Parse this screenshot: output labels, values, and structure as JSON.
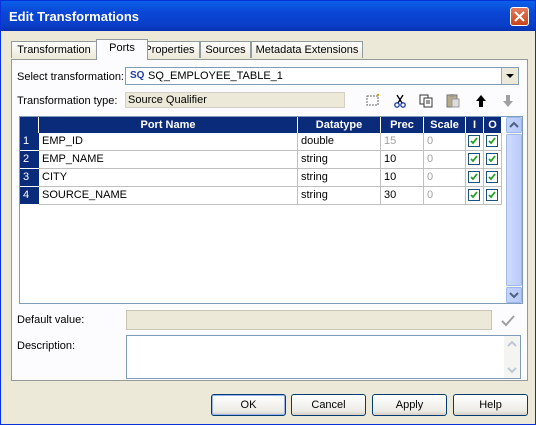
{
  "window": {
    "title": "Edit Transformations",
    "close_icon": "close-icon"
  },
  "tabs": [
    {
      "label": "Transformation"
    },
    {
      "label": "Ports"
    },
    {
      "label": "Properties"
    },
    {
      "label": "Sources"
    },
    {
      "label": "Metadata Extensions"
    }
  ],
  "active_tab": "Ports",
  "select_transformation": {
    "label": "Select transformation:",
    "badge": "SQ",
    "value": "SQ_EMPLOYEE_TABLE_1"
  },
  "transformation_type": {
    "label": "Transformation type:",
    "value": "Source Qualifier"
  },
  "toolbar": {
    "icons": [
      "new-port-icon",
      "cut-icon",
      "copy-icon",
      "paste-icon",
      "move-up-icon",
      "move-down-icon"
    ]
  },
  "ports_table": {
    "columns": [
      "Port Name",
      "Datatype",
      "Prec",
      "Scale",
      "I",
      "O"
    ],
    "rows": [
      {
        "num": "1",
        "name": "EMP_ID",
        "datatype": "double",
        "prec": "15",
        "scale": "0",
        "input": true,
        "output": true
      },
      {
        "num": "2",
        "name": "EMP_NAME",
        "datatype": "string",
        "prec": "10",
        "scale": "0",
        "input": true,
        "output": true
      },
      {
        "num": "3",
        "name": "CITY",
        "datatype": "string",
        "prec": "10",
        "scale": "0",
        "input": true,
        "output": true
      },
      {
        "num": "4",
        "name": "SOURCE_NAME",
        "datatype": "string",
        "prec": "30",
        "scale": "0",
        "input": true,
        "output": true
      }
    ]
  },
  "default_value": {
    "label": "Default value:",
    "value": ""
  },
  "description": {
    "label": "Description:",
    "value": ""
  },
  "buttons": {
    "ok": "OK",
    "cancel": "Cancel",
    "apply": "Apply",
    "help": "Help"
  },
  "colors": {
    "title_bar": "#0a46d6",
    "grid_header": "#0a2a7a",
    "dialog_bg": "#ece9d8"
  }
}
